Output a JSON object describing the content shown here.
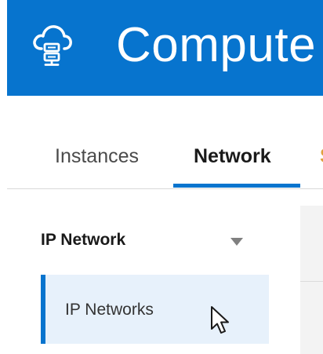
{
  "header": {
    "title": "Compute",
    "icon": "cloud-server-icon",
    "background_color": "#0774ce"
  },
  "tabs": [
    {
      "label": "Instances",
      "selected": false
    },
    {
      "label": "Network",
      "selected": true
    },
    {
      "label": "S",
      "selected": false
    }
  ],
  "sidebar": {
    "section_title": "IP Network",
    "section_toggle_icon": "triangle-down-icon",
    "items": [
      {
        "label": "IP Networks",
        "selected": true
      }
    ]
  },
  "accent_color": "#0774ce",
  "cursor_icon": "mouse-pointer-icon"
}
